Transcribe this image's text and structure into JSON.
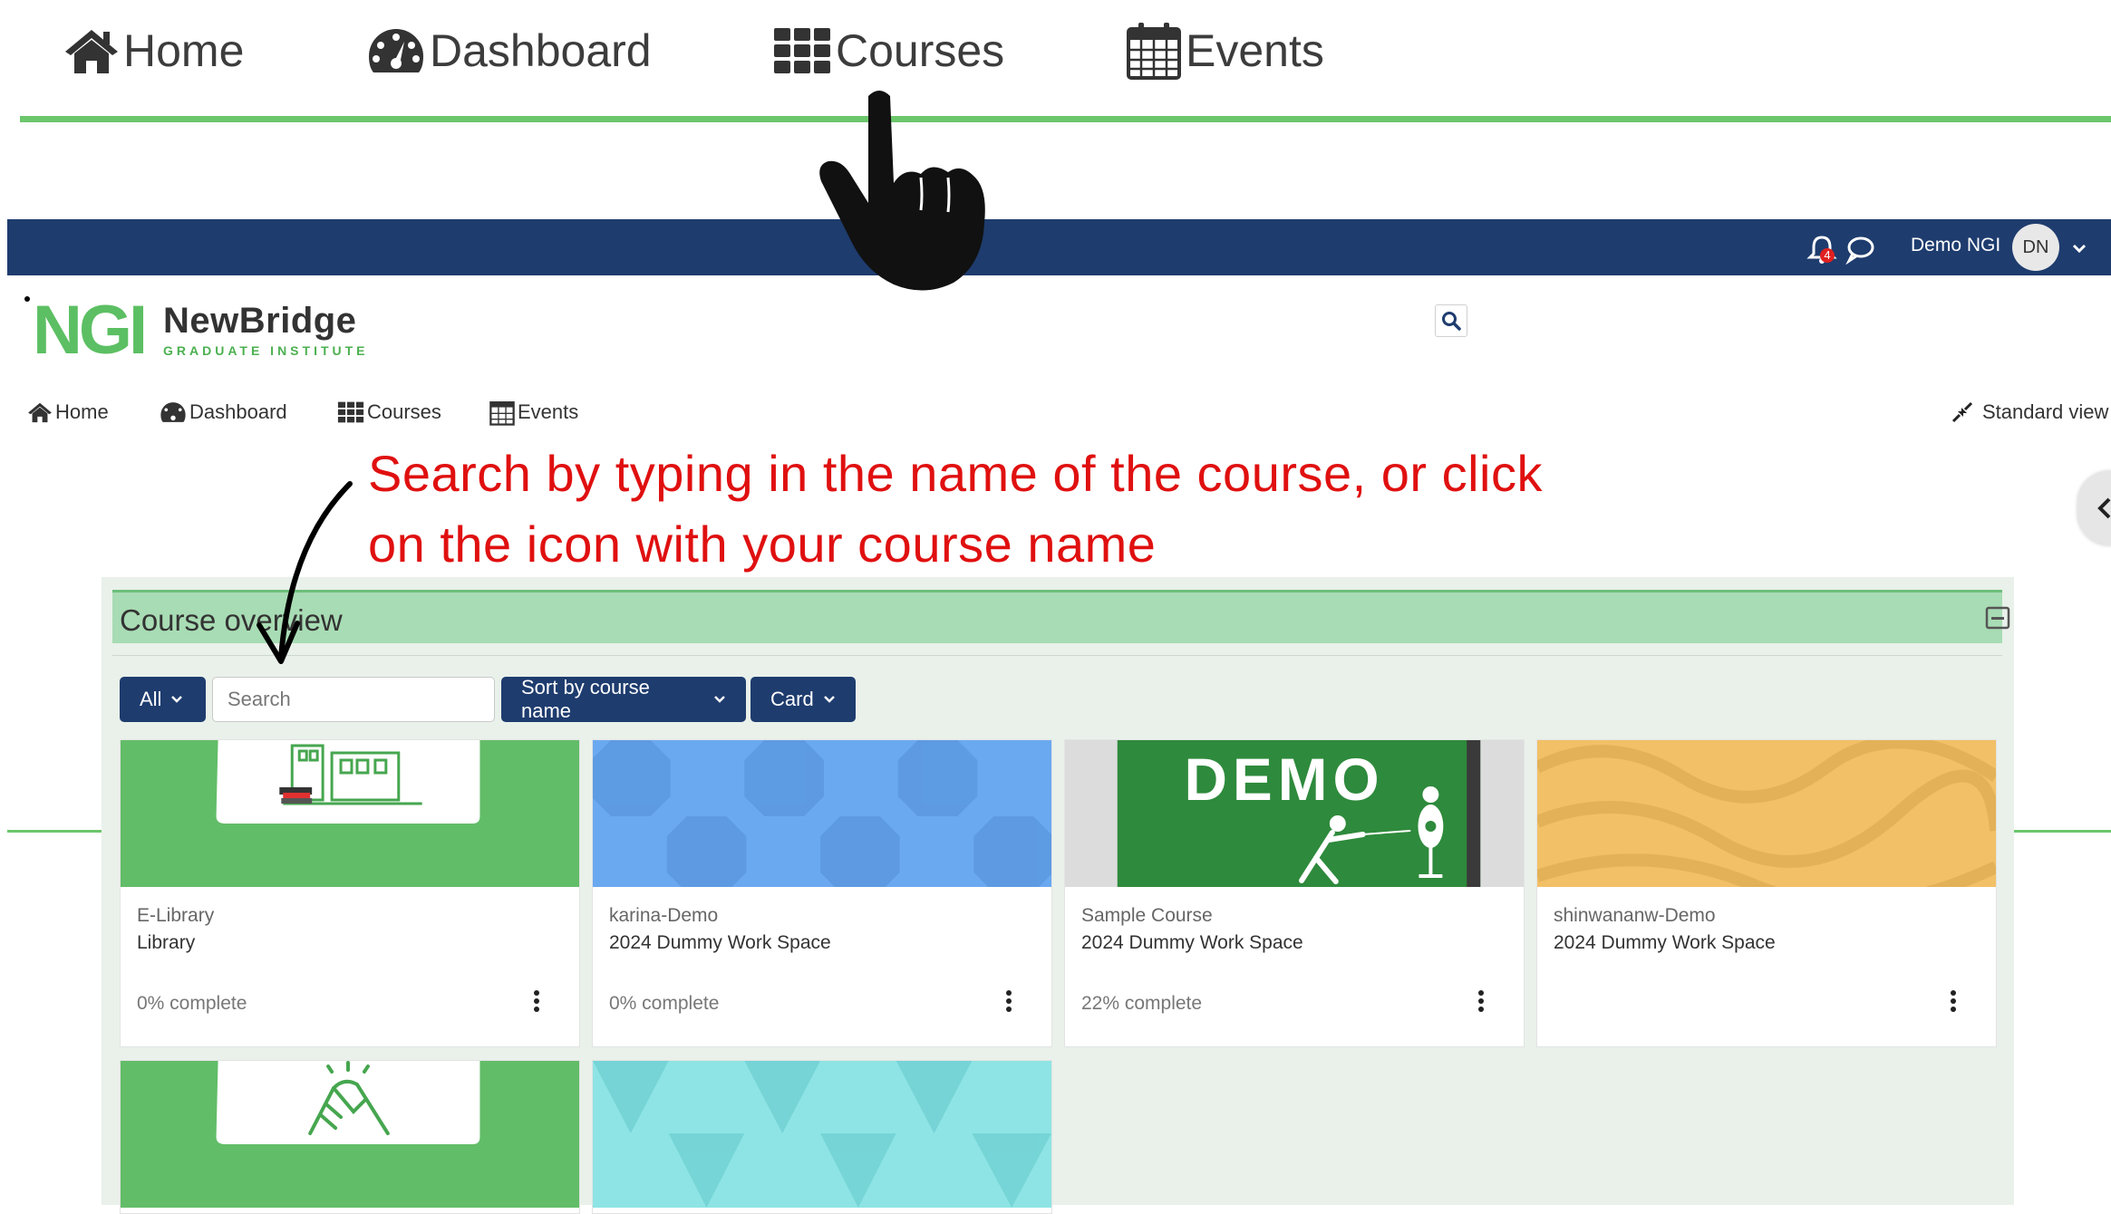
{
  "big_nav": {
    "items": [
      {
        "label": "Home",
        "icon": "home-icon"
      },
      {
        "label": "Dashboard",
        "icon": "dashboard-icon"
      },
      {
        "label": "Courses",
        "icon": "grid-icon"
      },
      {
        "label": "Events",
        "icon": "calendar-icon"
      }
    ],
    "accent": "#6cc66c"
  },
  "topbar": {
    "background": "#1e3c6e",
    "notification_count": "4",
    "user_name": "Demo NGI",
    "user_initials": "DN"
  },
  "logo": {
    "mark": "NGI",
    "name": "NewBridge",
    "subtitle": "GRADUATE INSTITUTE"
  },
  "small_nav": {
    "items": [
      {
        "label": "Home",
        "icon": "home-icon"
      },
      {
        "label": "Dashboard",
        "icon": "dashboard-icon"
      },
      {
        "label": "Courses",
        "icon": "grid-icon"
      },
      {
        "label": "Events",
        "icon": "calendar-icon"
      }
    ],
    "standard_view": "Standard view"
  },
  "annotation": {
    "line1": "Search by typing in the name of the course, or click",
    "line2": "on the icon with your course name",
    "color": "#e01010"
  },
  "overview": {
    "title": "Course overview",
    "filter_label": "All",
    "search_placeholder": "Search",
    "sort_label": "Sort by course name",
    "view_label": "Card",
    "courses": [
      {
        "category": "E-Library",
        "name": "Library",
        "progress": "0% complete"
      },
      {
        "category": "karina-Demo",
        "name": "2024 Dummy Work Space",
        "progress": "0% complete"
      },
      {
        "category": "Sample Course",
        "name": "2024 Dummy Work Space",
        "progress": "22% complete"
      },
      {
        "category": "shinwananw-Demo",
        "name": "2024 Dummy Work Space",
        "progress": ""
      }
    ],
    "demo_banner_text": "DEMO"
  }
}
